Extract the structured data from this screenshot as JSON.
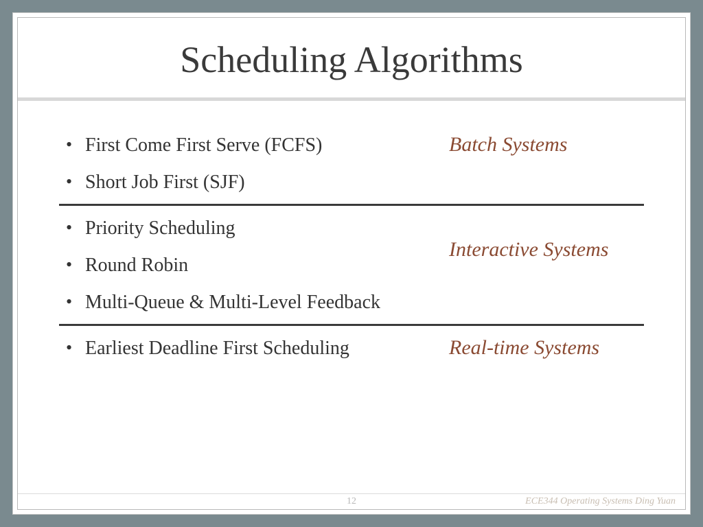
{
  "title": "Scheduling Algorithms",
  "sections": [
    {
      "items": [
        "First Come First Serve (FCFS)",
        "Short Job First (SJF)"
      ],
      "category": "Batch Systems"
    },
    {
      "items": [
        "Priority Scheduling",
        "Round Robin",
        "Multi-Queue & Multi-Level Feedback"
      ],
      "category": "Interactive Systems"
    },
    {
      "items": [
        "Earliest Deadline First Scheduling"
      ],
      "category": "Real-time Systems"
    }
  ],
  "page_number": "12",
  "footer_text": "ECE344 Operating Systems Ding Yuan"
}
